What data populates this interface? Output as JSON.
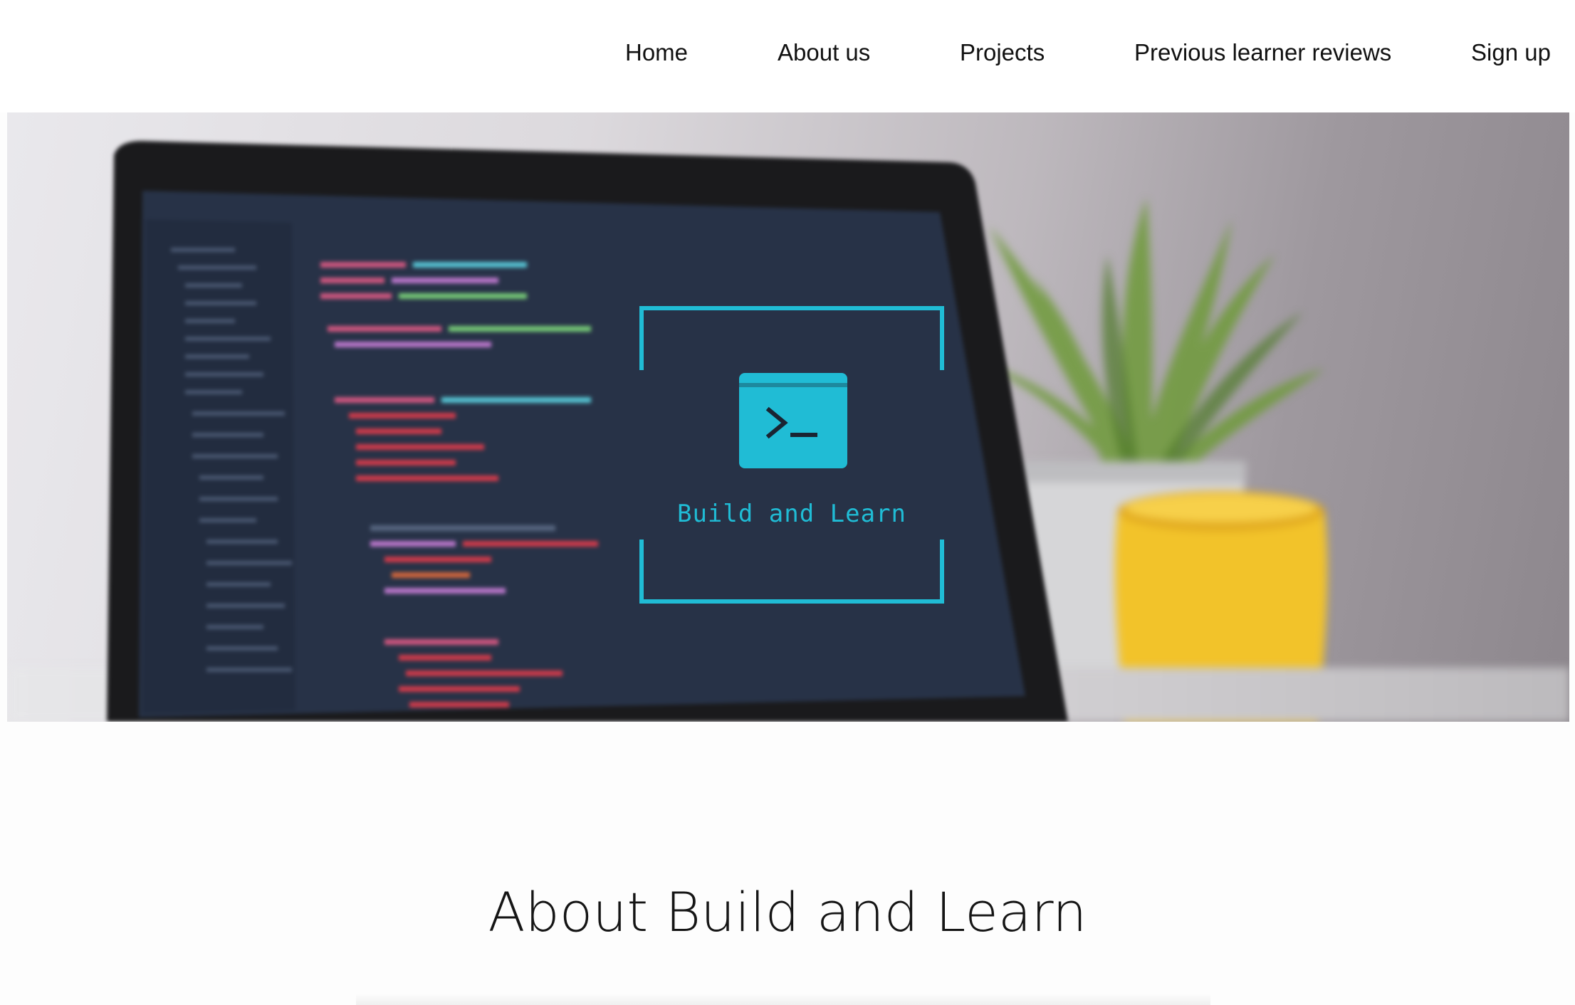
{
  "nav": {
    "items": [
      {
        "label": "Home"
      },
      {
        "label": "About us"
      },
      {
        "label": "Projects"
      },
      {
        "label": "Previous learner reviews"
      },
      {
        "label": "Sign up"
      }
    ]
  },
  "hero": {
    "brand_name": "Build and Learn",
    "icon": "terminal-window-icon",
    "accent_color": "#20bcd5"
  },
  "about": {
    "title": "About Build and Learn"
  }
}
